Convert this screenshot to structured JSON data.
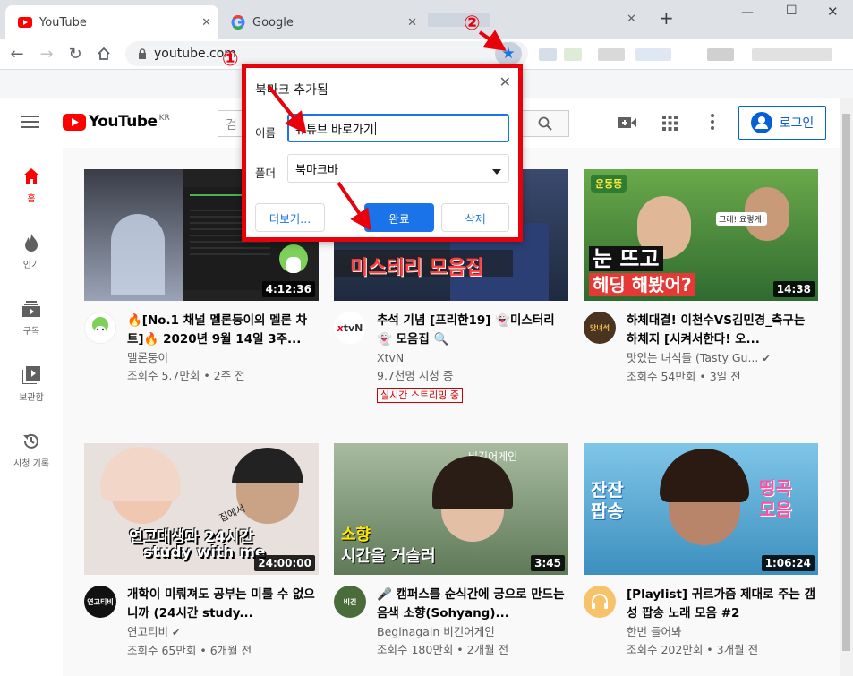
{
  "browser": {
    "tabs": [
      {
        "title": "YouTube",
        "active": true
      },
      {
        "title": "Google",
        "active": false
      }
    ],
    "new_tab_icon": "+",
    "window_controls": {
      "minimize": "—",
      "maximize": "☐",
      "close": "✕"
    },
    "address": "youtube.com"
  },
  "youtube": {
    "logo_text": "YouTube",
    "logo_region": "KR",
    "search_placeholder": "검",
    "login_label": "로그인",
    "sidebar": [
      {
        "label": "홈",
        "icon": "home-icon",
        "active": true
      },
      {
        "label": "인기",
        "icon": "fire-icon",
        "active": false
      },
      {
        "label": "구독",
        "icon": "subscriptions-icon",
        "active": false
      },
      {
        "label": "보관함",
        "icon": "library-icon",
        "active": false
      },
      {
        "label": "시청 기록",
        "icon": "history-icon",
        "active": false
      }
    ],
    "videos": [
      {
        "title": "🔥[No.1 채널 멜론둥이의 멜론 차트]🔥 2020년 9월 14일 3주...",
        "channel": "멜론둥이",
        "views": "조회수 5.7만회 • 2주 전",
        "duration": "4:12:36",
        "verified": false,
        "live": ""
      },
      {
        "title": "추석 기념 [프리한19] 👻미스터리👻 모음집 🔍",
        "channel": "XtvN",
        "views": "9.7천명 시청 중",
        "duration": "",
        "verified": false,
        "live": "실시간 스트리밍 중",
        "thumb_text": "미스테리 모음집"
      },
      {
        "title": "하체대결! 이천수VS김민경_축구는 하체지 [시켜서한다! 오...",
        "channel": "맛있는 녀석들 (Tasty Gu...",
        "views": "조회수 54만회 • 3일 전",
        "duration": "14:38",
        "verified": true,
        "live": "",
        "thumb_text1": "눈 뜨고",
        "thumb_text2": "헤딩 해봤어?",
        "thumb_sticker": "운동뚱",
        "thumb_bubble": "그래! 요렇게!"
      },
      {
        "title": "개학이 미뤄져도 공부는 미룰 수 없으니까 (24시간 study...",
        "channel": "연고티비",
        "views": "조회수 65만회 • 6개월 전",
        "duration": "24:00:00",
        "verified": true,
        "live": "",
        "thumb_text1": "연고대생과 24시간",
        "thumb_text2": "study with me",
        "thumb_note": "집에서"
      },
      {
        "title": "🎤 캠퍼스를 순식간에 궁으로 만드는 음색 소향(Sohyang)...",
        "channel": "Beginagain 비긴어게인",
        "views": "조회수 180만회 • 2개월 전",
        "duration": "3:45",
        "verified": false,
        "live": "",
        "thumb_text1": "소향",
        "thumb_text2": "시간을 거슬러",
        "thumb_logo": "비긴어게인"
      },
      {
        "title": "[Playlist] 귀르가즘 제대로 주는 갬성 팝송 노래 모음 #2",
        "channel": "한번 들어봐",
        "views": "조회수 202만회 • 3개월 전",
        "duration": "1:06:24",
        "verified": false,
        "live": "",
        "thumb_text1": "잔잔 팝송",
        "thumb_text2": "띵곡 모음"
      }
    ]
  },
  "bookmark_dialog": {
    "title": "북마크 추가됨",
    "name_label": "이름",
    "name_value": "유튜브 바로가기",
    "folder_label": "폴더",
    "folder_value": "북마크바",
    "more_button": "더보기...",
    "done_button": "완료",
    "delete_button": "삭제"
  },
  "annotations": {
    "step1": "①",
    "step2": "②"
  },
  "colors": {
    "youtube_red": "#ff0000",
    "chrome_blue": "#1a73e8",
    "annotation_red": "#e8000b",
    "live_red": "#cc0000"
  }
}
